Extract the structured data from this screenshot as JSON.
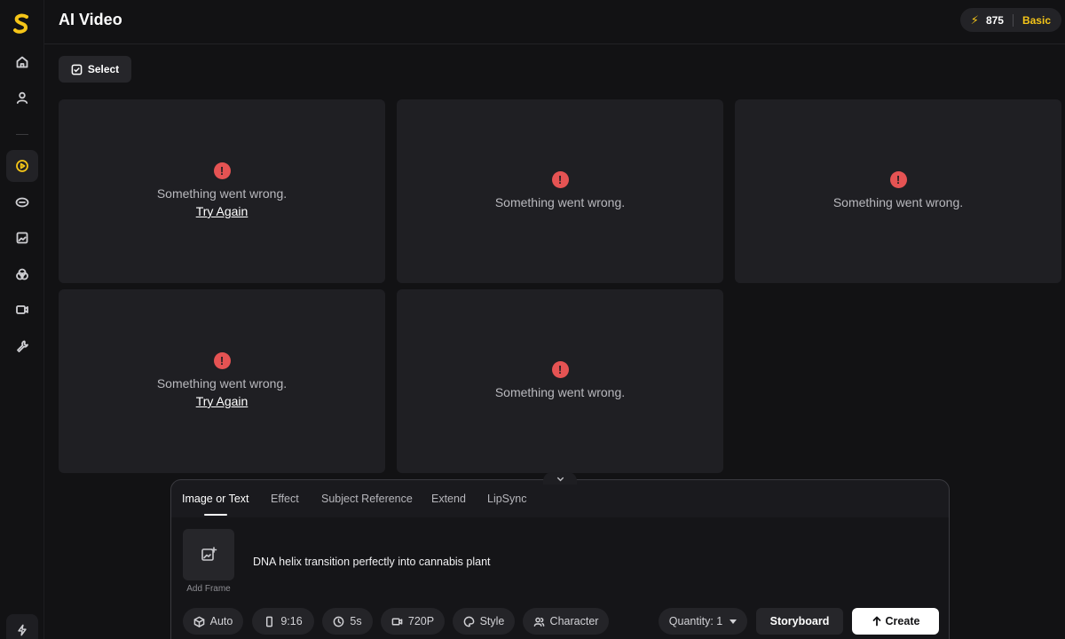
{
  "header": {
    "title": "AI Video",
    "credits": {
      "count": "875",
      "plan": "Basic",
      "icon": "lightning-bolt-icon"
    }
  },
  "sidebar": {
    "items": [
      {
        "icon": "home-icon"
      },
      {
        "icon": "user-icon"
      },
      {
        "icon": "play-circle-icon",
        "active": true
      },
      {
        "icon": "face-icon"
      },
      {
        "icon": "image-icon"
      },
      {
        "icon": "layers-icon"
      },
      {
        "icon": "video-icon"
      },
      {
        "icon": "wrench-icon"
      }
    ],
    "bottom_icon": "lightning-icon"
  },
  "toolbar": {
    "select_label": "Select"
  },
  "cards": [
    {
      "message": "Something went wrong.",
      "action": "Try Again"
    },
    {
      "message": "Something went wrong."
    },
    {
      "message": "Something went wrong."
    },
    {
      "message": "Something went wrong.",
      "action": "Try Again"
    },
    {
      "message": "Something went wrong."
    }
  ],
  "panel": {
    "tabs": [
      "Image or Text",
      "Effect",
      "Subject Reference",
      "Extend",
      "LipSync"
    ],
    "active_tab": "Image or Text",
    "add_frame_label": "Add Frame",
    "prompt": "DNA helix transition perfectly into cannabis plant",
    "chips": [
      "Auto",
      "9:16",
      "5s",
      "720P",
      "Style",
      "Character"
    ],
    "quantity": "Quantity: 1",
    "storyboard_label": "Storyboard",
    "create_label": "Create"
  },
  "colors": {
    "accent": "#f5c518",
    "error": "#e55353",
    "background": "#121214",
    "card": "#1f1f23"
  }
}
